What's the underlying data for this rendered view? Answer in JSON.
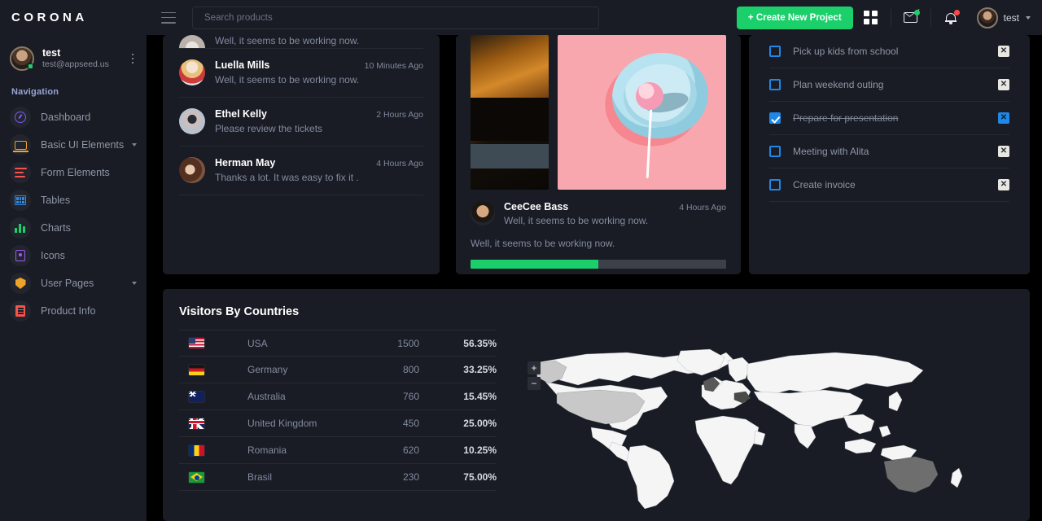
{
  "navbar": {
    "brand": "CORONA",
    "menu_toggle_icon": "hamburger-icon",
    "search": {
      "placeholder": "Search products",
      "value": ""
    },
    "create_button": "+ Create New Project",
    "grid_icon": "grid-apps-icon",
    "mail_icon": "envelope-icon",
    "bell_icon": "bell-icon",
    "username": "test",
    "accent_green": "#1bcf6b"
  },
  "sidebar": {
    "profile": {
      "name": "test",
      "email": "test@appseed.us",
      "status": "online"
    },
    "section_title": "Navigation",
    "items": [
      {
        "label": "Dashboard",
        "icon": "speedometer-icon",
        "color": "#7a5cf0",
        "has_arrow": false
      },
      {
        "label": "Basic UI Elements",
        "icon": "laptop-icon",
        "color": "#f0a32a",
        "has_arrow": true
      },
      {
        "label": "Form Elements",
        "icon": "form-lines-icon",
        "color": "#f4534e",
        "has_arrow": false
      },
      {
        "label": "Tables",
        "icon": "table-grid-icon",
        "color": "#2e8ae6",
        "has_arrow": false
      },
      {
        "label": "Charts",
        "icon": "bar-chart-icon",
        "color": "#1bcf6b",
        "has_arrow": false
      },
      {
        "label": "Icons",
        "icon": "contact-card-icon",
        "color": "#9b5cf0",
        "has_arrow": false
      },
      {
        "label": "User Pages",
        "icon": "shield-icon",
        "color": "#f0a32a",
        "has_arrow": true
      },
      {
        "label": "Product Info",
        "icon": "document-icon",
        "color": "#f4534e",
        "has_arrow": false
      }
    ]
  },
  "chats": [
    {
      "name": "",
      "message": "Well, it seems to be working now.",
      "time": "",
      "cut_off": true
    },
    {
      "name": "Luella Mills",
      "message": "Well, it seems to be working now.",
      "time": "10 Minutes Ago",
      "cut_off": false
    },
    {
      "name": "Ethel Kelly",
      "message": "Please review the tickets",
      "time": "2 Hours Ago",
      "cut_off": false
    },
    {
      "name": "Herman May",
      "message": "Thanks a lot. It was easy to fix it .",
      "time": "4 Hours Ago",
      "cut_off": false
    }
  ],
  "feed": {
    "author": "CeeCee Bass",
    "subtitle": "Well, it seems to be working now.",
    "time": "4 Hours Ago",
    "body_text": "Well, it seems to be working now.",
    "progress_percent": 50,
    "progress_color": "#1bcf6b",
    "image_left_alt": "mountain-landscape-photo",
    "image_right_alt": "pink-lollipop-on-blue-plate-photo"
  },
  "todo": {
    "items": [
      {
        "label": "Pick up kids from school",
        "done": false,
        "delete_icon": "close-icon"
      },
      {
        "label": "Plan weekend outing",
        "done": false,
        "delete_icon": "close-icon"
      },
      {
        "label": "Prepare for presentation",
        "done": true,
        "delete_icon": "close-icon"
      },
      {
        "label": "Meeting with Alita",
        "done": false,
        "delete_icon": "close-icon"
      },
      {
        "label": "Create invoice",
        "done": false,
        "delete_icon": "close-icon"
      }
    ],
    "checkbox_color": "#1f87e5"
  },
  "visitors": {
    "title": "Visitors By Countries",
    "rows": [
      {
        "flag": "usa-flag",
        "country": "USA",
        "count": "1500",
        "percent": "56.35%"
      },
      {
        "flag": "germany-flag",
        "country": "Germany",
        "count": "800",
        "percent": "33.25%"
      },
      {
        "flag": "australia-flag",
        "country": "Australia",
        "count": "760",
        "percent": "15.45%"
      },
      {
        "flag": "united-kingdom-flag",
        "country": "United Kingdom",
        "count": "450",
        "percent": "25.00%"
      },
      {
        "flag": "romania-flag",
        "country": "Romania",
        "count": "620",
        "percent": "10.25%"
      },
      {
        "flag": "brasil-flag",
        "country": "Brasil",
        "count": "230",
        "percent": "75.00%"
      }
    ],
    "map": {
      "zoom_in_label": "+",
      "zoom_out_label": "−",
      "highlighted_countries": [
        "USA",
        "Australia",
        "United Kingdom",
        "Romania"
      ],
      "land_color": "#f5f5f5",
      "highlight_colors": {
        "USA": "#c8c8c8",
        "Australia": "#6e6e6e",
        "United Kingdom": "#585858",
        "Romania": "#4a4a4a"
      },
      "ocean_color": "#141720"
    }
  },
  "theme": {
    "page_background": "#000000",
    "card_background": "#191c24",
    "text_primary": "#ffffff",
    "text_muted": "#838ba0"
  }
}
